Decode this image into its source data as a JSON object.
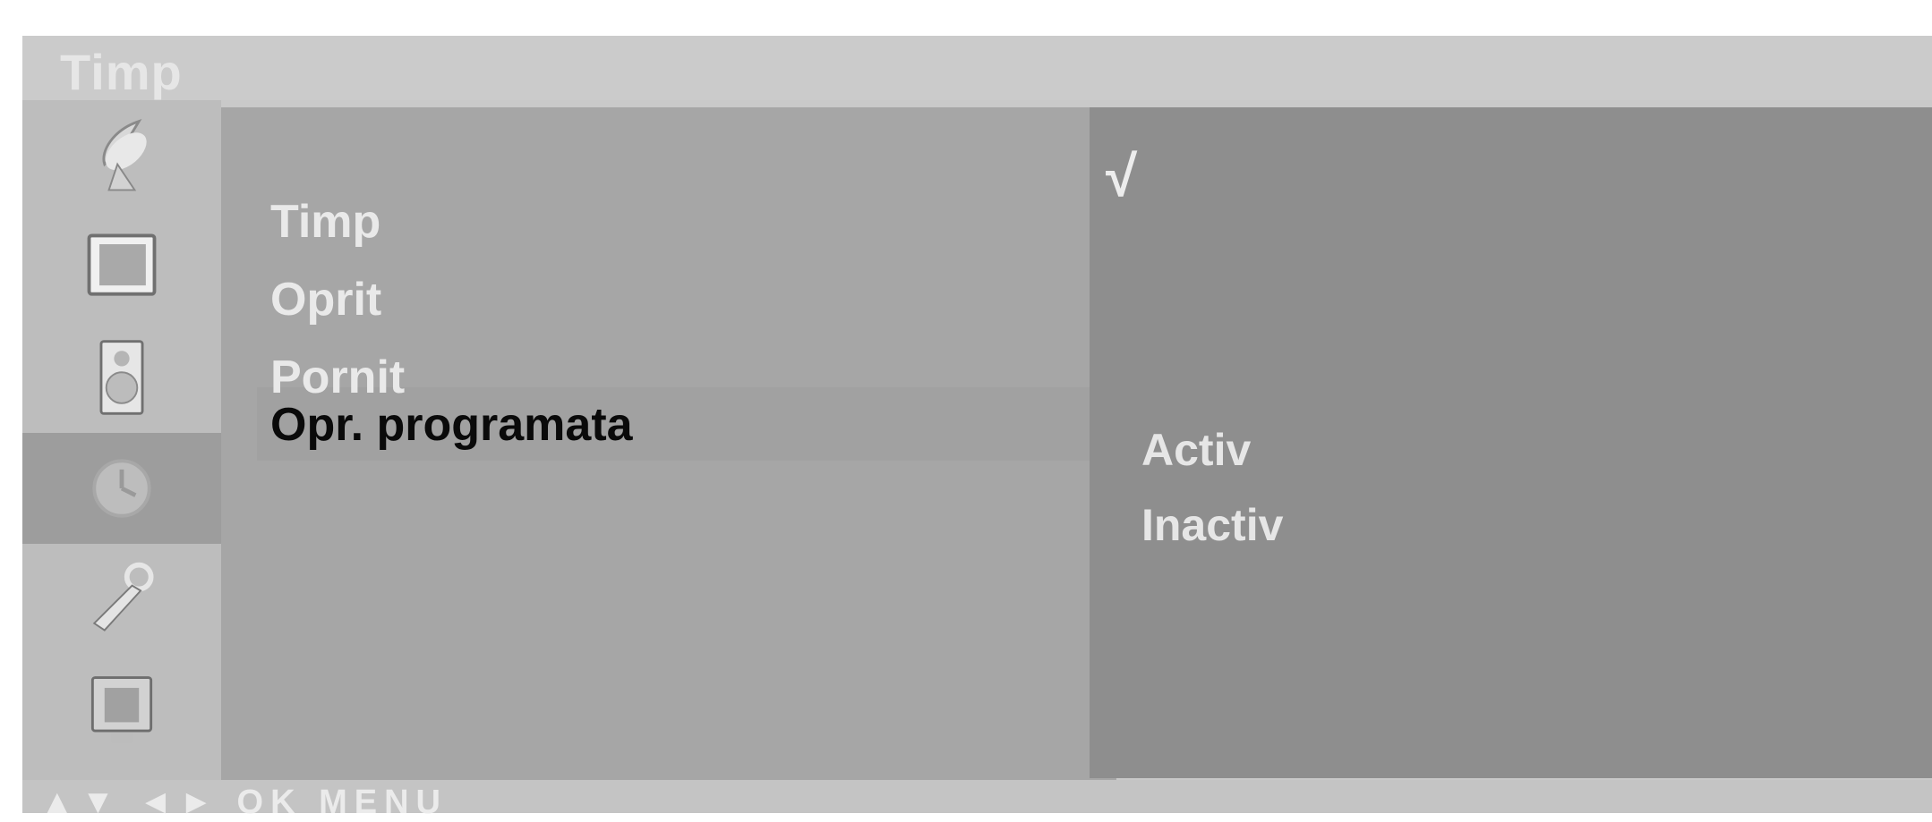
{
  "header": {
    "title": "Timp"
  },
  "icons": [
    {
      "name": "satellite-dish-icon"
    },
    {
      "name": "tv-screen-icon"
    },
    {
      "name": "speaker-icon"
    },
    {
      "name": "clock-icon",
      "selected": true
    },
    {
      "name": "wrench-icon"
    },
    {
      "name": "input-monitor-icon"
    }
  ],
  "menu": {
    "items": [
      {
        "label": "Timp"
      },
      {
        "label": "Oprit"
      },
      {
        "label": "Pornit"
      },
      {
        "label": "Opr. programata",
        "active": true
      }
    ]
  },
  "submenu": {
    "check": "√",
    "options": [
      {
        "label": "Activ"
      },
      {
        "label": "Inactiv"
      }
    ]
  },
  "footer": {
    "hint": "▲▼ ◄► OK MENU"
  },
  "colors": {
    "panel": "#a6a6a6",
    "subpanel": "#8e8e8e",
    "selected_icon": "#9d9d9d"
  }
}
